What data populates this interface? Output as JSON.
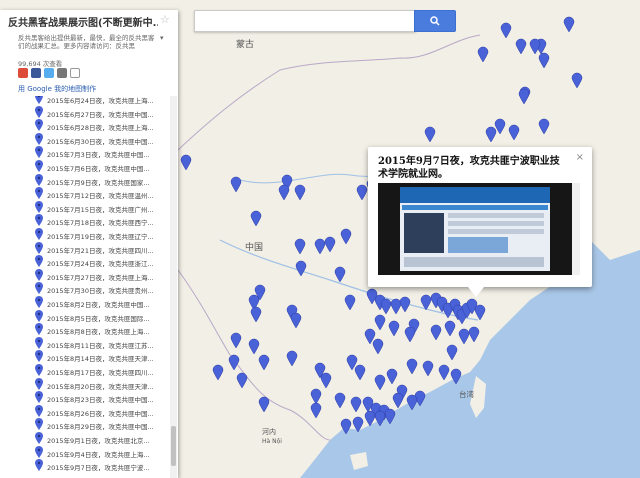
{
  "panel": {
    "title": "反共黑客战果展示图(不断更新中...)",
    "description": "反共黑客给出提供最新，最快，最全的反共黑客们的战果汇总。更多内容请访问：反共黑",
    "views": "99,694 次查看",
    "made_with": "用 Google 我的地图制作",
    "share_icons": [
      "google-plus-icon",
      "facebook-icon",
      "twitter-icon",
      "email-icon",
      "share-icon"
    ],
    "list": [
      "2015年6月24日夜，攻克共匪上海...",
      "2015年6月27日夜，攻克共匪中国...",
      "2015年6月28日夜，攻克共匪上海...",
      "2015年6月30日夜，攻克共匪中国...",
      "2015年7月3日夜，攻克共匪中国...",
      "2015年7月6日夜，攻克共匪中国...",
      "2015年7月9日夜，攻克共匪国家...",
      "2015年7月12日夜，攻克共匪温州...",
      "2015年7月15日夜，攻克共匪广州...",
      "2015年7月18日夜，攻克共匪西宁...",
      "2015年7月19日夜，攻克共匪辽宁...",
      "2015年7月21日夜，攻克共匪四川...",
      "2015年7月24日夜，攻克共匪浙江...",
      "2015年7月27日夜，攻克共匪上海...",
      "2015年7月30日夜，攻克共匪贵州...",
      "2015年8月2日夜，攻克共匪中国...",
      "2015年8月5日夜，攻克共匪国际...",
      "2015年8月8日夜，攻克共匪上海...",
      "2015年8月11日夜，攻克共匪江苏...",
      "2015年8月14日夜，攻克共匪天津...",
      "2015年8月17日夜，攻克共匪四川...",
      "2015年8月20日夜，攻克共匪天津...",
      "2015年8月23日夜，攻克共匪中国...",
      "2015年8月26日夜，攻克共匪中国...",
      "2015年8月29日夜，攻克共匪中国...",
      "2015年9月1日夜，攻克共匪北京...",
      "2015年9月4日夜，攻克共匪上海...",
      "2015年9月7日夜，攻克共匪宁波..."
    ]
  },
  "popup": {
    "title": "2015年9月7日夜，攻克共匪宁波职业技术学院就业网。",
    "close_label": "×"
  },
  "map_labels": {
    "mongolia": "蒙古",
    "china": "中国",
    "taiwan": "台湾",
    "hanoi": "河内",
    "hanoi_sub": "Hà Nội"
  },
  "colors": {
    "marker": "#4a62d8",
    "land": "#f2efe6",
    "water": "#a9c7e8",
    "search_button": "#4a7cde"
  }
}
